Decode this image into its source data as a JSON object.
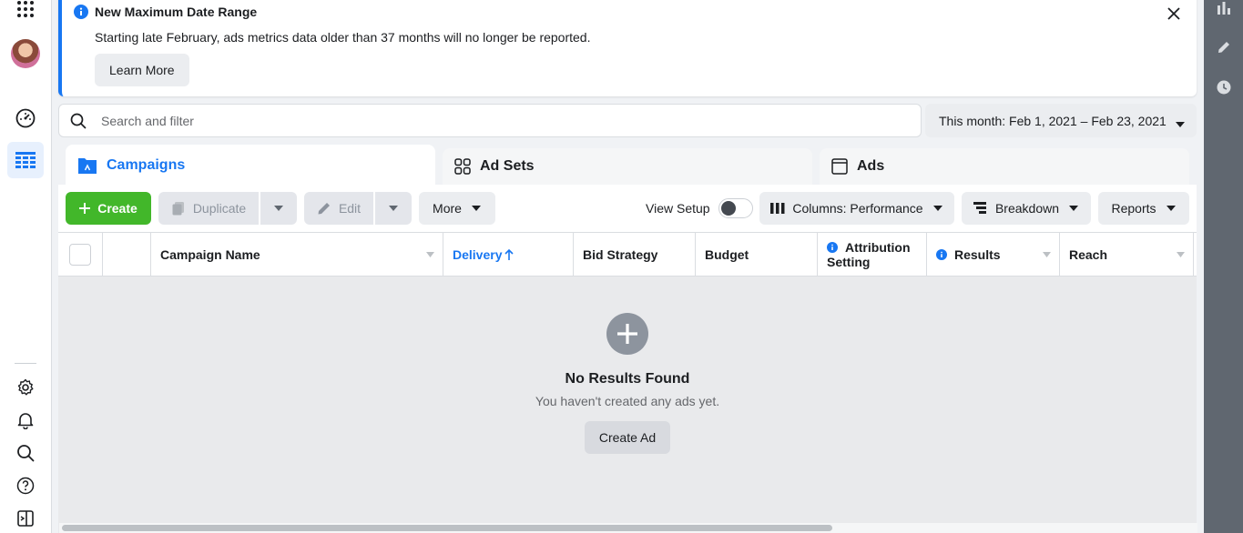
{
  "notice": {
    "title": "New Maximum Date Range",
    "body": "Starting late February, ads metrics data older than 37 months will no longer be reported.",
    "button": "Learn More"
  },
  "search": {
    "placeholder": "Search and filter"
  },
  "date_range": {
    "label": "This month: Feb 1, 2021 – Feb 23, 2021"
  },
  "tabs": [
    {
      "label": "Campaigns",
      "icon": "folder-icon",
      "active": true
    },
    {
      "label": "Ad Sets",
      "icon": "grid-icon",
      "active": false
    },
    {
      "label": "Ads",
      "icon": "ad-frame-icon",
      "active": false
    }
  ],
  "toolbar": {
    "create": "Create",
    "duplicate": "Duplicate",
    "edit": "Edit",
    "more": "More",
    "view_setup": "View Setup",
    "columns": "Columns: Performance",
    "breakdown": "Breakdown",
    "reports": "Reports"
  },
  "table": {
    "columns": [
      "Campaign Name",
      "Delivery",
      "Bid Strategy",
      "Budget",
      "Attribution Setting",
      "Results",
      "Reach"
    ],
    "attribution_line1": "Attribution",
    "attribution_line2": "Setting",
    "sorted_column": "Delivery"
  },
  "empty_state": {
    "title": "No Results Found",
    "subtitle": "You haven't created any ads yet.",
    "button": "Create Ad"
  },
  "colors": {
    "accent": "#1877f2",
    "create_green": "#42b72a",
    "rail": "#606770"
  }
}
